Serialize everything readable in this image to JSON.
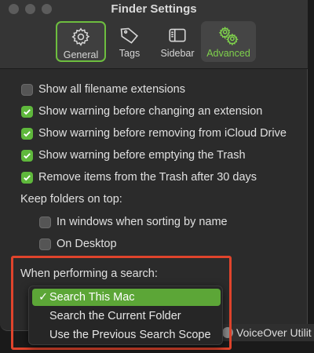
{
  "window": {
    "title": "Finder Settings"
  },
  "tabs": [
    {
      "label": "General",
      "icon": "gear-icon",
      "selected": true
    },
    {
      "label": "Tags",
      "icon": "tag-icon",
      "selected": false
    },
    {
      "label": "Sidebar",
      "icon": "sidebar-icon",
      "selected": false
    },
    {
      "label": "Advanced",
      "icon": "gears-icon",
      "selected": false,
      "hovered": true
    }
  ],
  "options": [
    {
      "label": "Show all filename extensions",
      "checked": false
    },
    {
      "label": "Show warning before changing an extension",
      "checked": true
    },
    {
      "label": "Show warning before removing from iCloud Drive",
      "checked": true
    },
    {
      "label": "Show warning before emptying the Trash",
      "checked": true
    },
    {
      "label": "Remove items from the Trash after 30 days",
      "checked": true
    }
  ],
  "keep_folders": {
    "heading": "Keep folders on top:",
    "items": [
      {
        "label": "In windows when sorting by name",
        "checked": false
      },
      {
        "label": "On Desktop",
        "checked": false
      }
    ]
  },
  "search": {
    "heading": "When performing a search:",
    "options": [
      {
        "label": "Search This Mac",
        "selected": true
      },
      {
        "label": "Search the Current Folder",
        "selected": false
      },
      {
        "label": "Use the Previous Search Scope",
        "selected": false
      }
    ],
    "check_mark": "✓"
  },
  "background_app": {
    "label": "VoiceOver Utilit"
  },
  "colors": {
    "accent": "#5fb83c",
    "highlight_border": "#e0442c",
    "window_bg": "#2b2b2b"
  }
}
